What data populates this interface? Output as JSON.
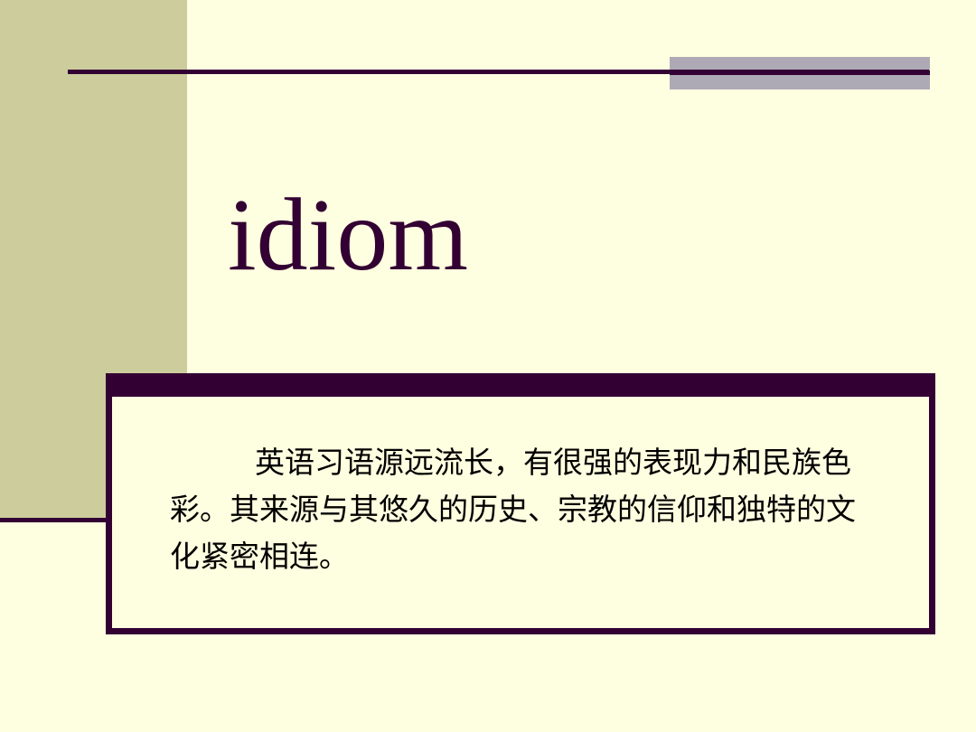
{
  "slide": {
    "title": "idiom",
    "body": "英语习语源远流长，有很强的表现力和民族色彩。其来源与其悠久的历史、宗教的信仰和独特的文化紧密相连。"
  },
  "colors": {
    "background": "#fefee0",
    "left_band": "#cccc9d",
    "accent_dark": "#330033",
    "accent_gray": "#aeaab5",
    "text": "#000000"
  }
}
